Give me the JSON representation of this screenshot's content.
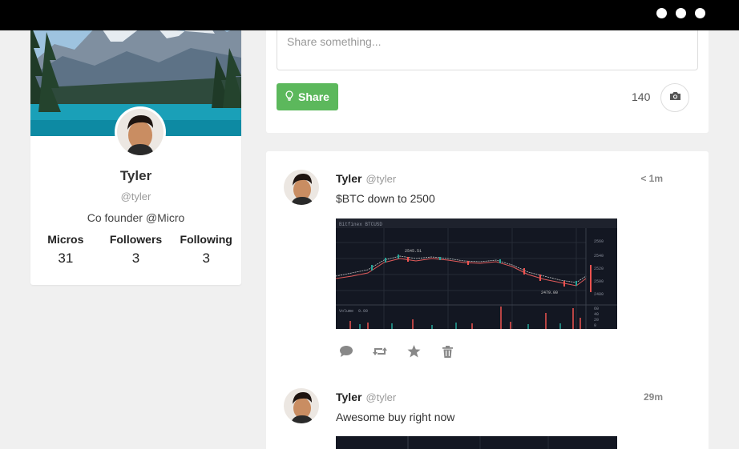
{
  "window": {
    "controls": [
      "dot",
      "dot",
      "dot"
    ]
  },
  "profile": {
    "cover_image": "mountain-lake-cover",
    "avatar": "user-avatar",
    "name": "Tyler",
    "handle": "@tyler",
    "bio": "Co founder @Micro",
    "stats": [
      {
        "label": "Micros",
        "value": "31"
      },
      {
        "label": "Followers",
        "value": "3"
      },
      {
        "label": "Following",
        "value": "3"
      }
    ]
  },
  "composer": {
    "placeholder": "Share something...",
    "share_label": "Share",
    "share_icon": "lightbulb-icon",
    "char_count": "140",
    "camera_icon": "camera-icon",
    "share_color": "#5cb85c"
  },
  "feed": {
    "posts": [
      {
        "author": "Tyler",
        "handle": "@tyler",
        "time": "< 1m",
        "text": "$BTC down to 2500",
        "image": "btc-price-chart",
        "chart_text": {
          "toolbar": "Bitfinex BTCUSD",
          "high_label": "2545.51",
          "low_label": "2479.00",
          "volume_label": "Volume",
          "volume_value": "0.00",
          "price_ticks": [
            "2560",
            "2540",
            "2520",
            "2500",
            "2480"
          ],
          "volume_ticks": [
            "60",
            "40",
            "20",
            "0"
          ]
        }
      },
      {
        "author": "Tyler",
        "handle": "@tyler",
        "time": "29m",
        "text": "Awesome buy right now",
        "image": "chart-image"
      }
    ],
    "actions": [
      "comment-icon",
      "retweet-icon",
      "star-icon",
      "trash-icon"
    ]
  }
}
